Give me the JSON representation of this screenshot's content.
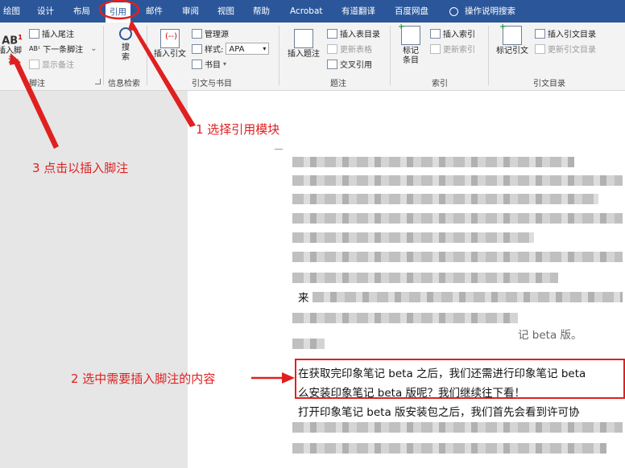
{
  "tabs": [
    {
      "label": "绘图",
      "active": false
    },
    {
      "label": "设计",
      "active": false
    },
    {
      "label": "布局",
      "active": false
    },
    {
      "label": "引用",
      "active": true
    },
    {
      "label": "邮件",
      "active": false
    },
    {
      "label": "审阅",
      "active": false
    },
    {
      "label": "视图",
      "active": false
    },
    {
      "label": "帮助",
      "active": false
    },
    {
      "label": "Acrobat",
      "active": false
    },
    {
      "label": "有道翻译",
      "active": false
    },
    {
      "label": "百度网盘",
      "active": false
    },
    {
      "label": "操作说明搜索",
      "active": false
    }
  ],
  "ribbon": {
    "footnotes": {
      "insert_footnote": "插入脚注",
      "insert_endnote": "插入尾注",
      "next_footnote": "下一条脚注",
      "show_notes": "显示备注",
      "group": "脚注"
    },
    "research": {
      "search": "搜索",
      "group": "信息检索"
    },
    "citations": {
      "insert_citation": "插入引文",
      "manage_sources": "管理源",
      "style_label": "样式:",
      "style_value": "APA",
      "bibliography": "书目",
      "group": "引文与书目"
    },
    "captions": {
      "insert_caption": "插入题注",
      "insert_table_of_figures": "插入表目录",
      "update_table": "更新表格",
      "cross_reference": "交叉引用",
      "group": "题注"
    },
    "index": {
      "mark_entry": "标记条目",
      "insert_index": "插入索引",
      "update_index": "更新索引",
      "group": "索引"
    },
    "toa": {
      "mark_citation": "标记引文",
      "insert_toa": "插入引文目录",
      "update_toa": "更新引文目录",
      "group": "引文目录"
    }
  },
  "document": {
    "partial_right": "记 beta 版。",
    "partial_left": "来",
    "selected_line1": "在获取完印象笔记 beta 之后，我们还需进行印象笔记 beta",
    "selected_line2": "么安装印象笔记 beta 版呢？我们继续往下看！",
    "line3": "打开印象笔记 beta 版安装包之后，我们首先会看到许可协"
  },
  "annotations": {
    "step1": "1 选择引用模块",
    "step2": "2 选中需要插入脚注的内容",
    "step3": "3 点击以插入脚注"
  },
  "colors": {
    "accent": "#2b579a",
    "annotation": "#e02020"
  }
}
